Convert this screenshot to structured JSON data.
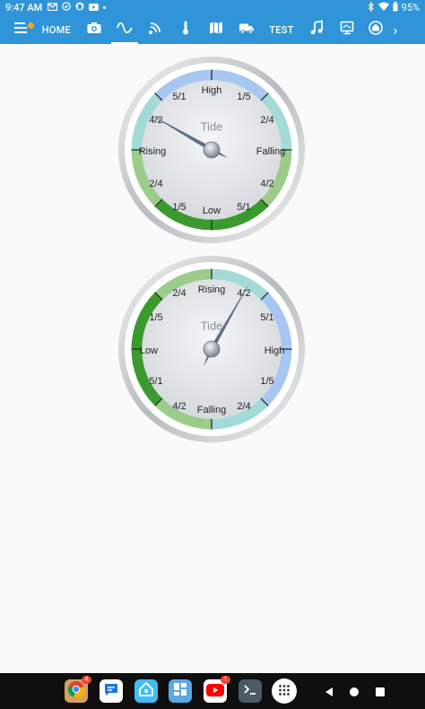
{
  "status_bar": {
    "time": "9:47 AM",
    "battery": "95%"
  },
  "toolbar": {
    "home_label": "HOME",
    "test_label": "TEST",
    "active_tab": "wave",
    "chevron": "›"
  },
  "gauges": [
    {
      "title": "Tide",
      "label_high": "High",
      "label_low": "Low",
      "label_rising": "Rising",
      "label_falling": "Falling",
      "label_ul": "5/1",
      "label_ur": "1/5",
      "label_ul2": "4/2",
      "label_ur2": "2/4",
      "label_ll": "2/4",
      "label_lr": "4/2",
      "label_ll2": "1/5",
      "label_lr2": "5/1"
    },
    {
      "title": "Tide",
      "label_rising": "Rising",
      "label_falling": "Falling",
      "label_low": "Low",
      "label_high": "High",
      "label_ul": "2/4",
      "label_ur": "4/2",
      "label_ul2": "1/5",
      "label_ur2": "5/1",
      "label_ll": "5/1",
      "label_lr": "1/5",
      "label_ll2": "4/2",
      "label_lr2": "2/4"
    }
  ],
  "colors": {
    "brand": "#2f95d8",
    "gauge_blue": "#a7c7f2",
    "gauge_cyan": "#a3dad8",
    "gauge_lightgreen": "#9ccc8a",
    "gauge_green": "#3a9a2e"
  },
  "dock": {
    "youtube_badge": "1",
    "chrome_badge": "4"
  }
}
